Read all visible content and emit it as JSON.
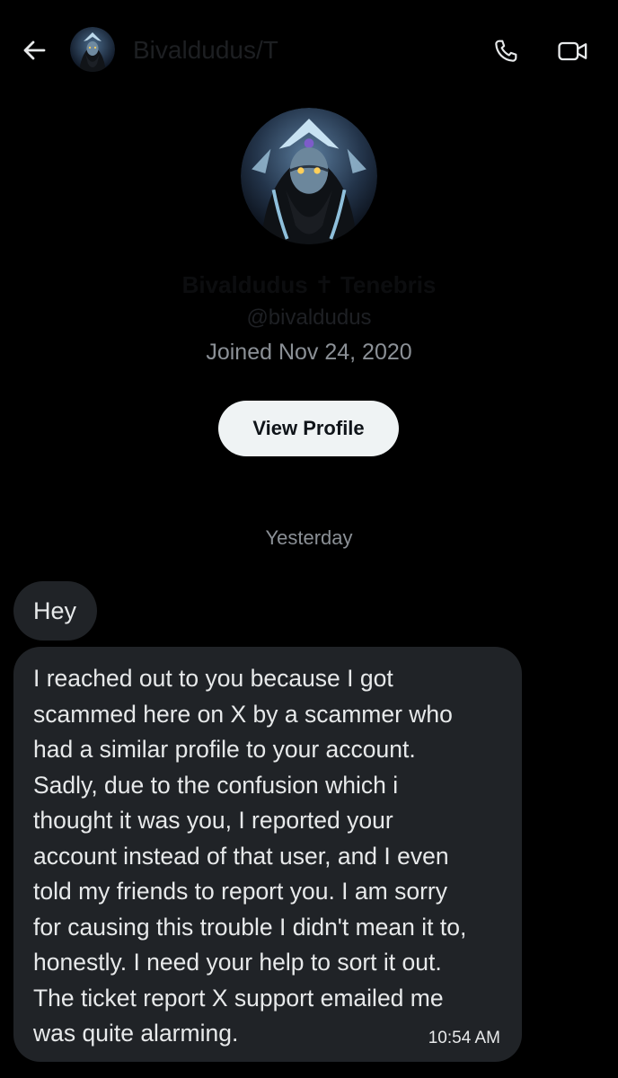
{
  "header": {
    "name": "Bivaldudus/T",
    "back_icon": "arrow-left-icon",
    "call_icon": "phone-icon",
    "video_icon": "video-camera-icon"
  },
  "profile": {
    "name": "Bivaldudus ✝ Tenebris",
    "handle": "@bivaldudus",
    "joined": "Joined Nov 24, 2020",
    "view_profile_label": "View Profile"
  },
  "conversation": {
    "day_separator": "Yesterday",
    "messages": [
      {
        "text": "Hey"
      },
      {
        "text": "I reached out to you because I got\nscammed here on X by a scammer who\nhad a similar profile to your account.\nSadly, due to the confusion which i\nthought it was you, I reported your\naccount instead of that user, and I even\ntold my friends to report you. I am sorry\nfor causing this trouble I didn't mean it to,\nhonestly. I need your help to sort it out.\nThe ticket report X support emailed me\nwas quite alarming.",
        "time": "10:54 AM"
      }
    ]
  },
  "colors": {
    "background": "#000000",
    "bubble": "#202327",
    "text": "#e7e9ea",
    "muted": "#8b9096",
    "button_bg": "#eff3f4",
    "button_text": "#0f1419"
  }
}
